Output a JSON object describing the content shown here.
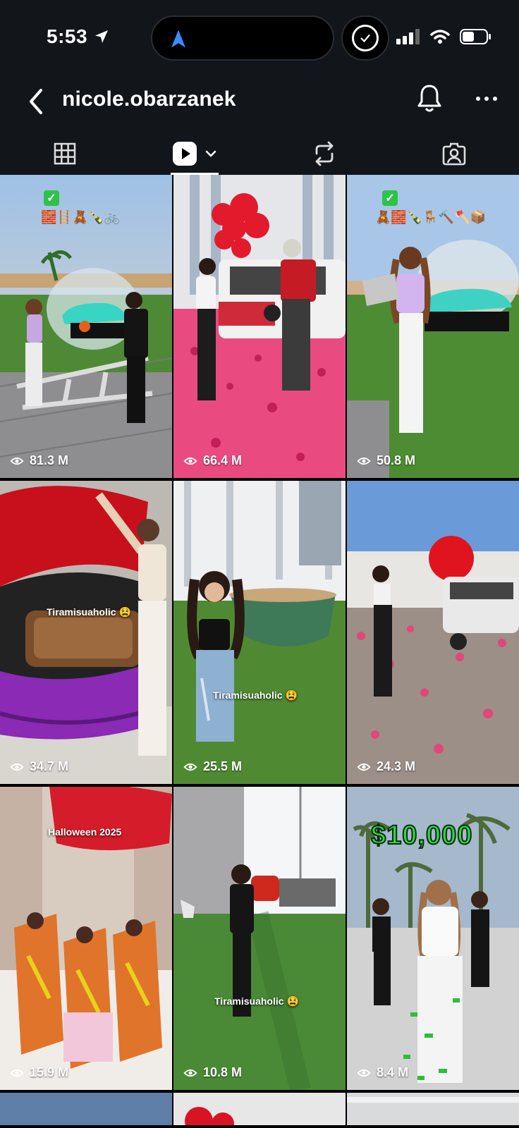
{
  "status_bar": {
    "time": "5:53"
  },
  "header": {
    "username": "nicole.obarzanek"
  },
  "tabs": [
    {
      "name": "grid",
      "active": false
    },
    {
      "name": "reels",
      "active": true
    },
    {
      "name": "reposts",
      "active": false
    },
    {
      "name": "tagged",
      "active": false
    }
  ],
  "tiles": [
    {
      "views": "81.3 M",
      "caption": "",
      "emojis": "🧱🪜🧸🍾🚲"
    },
    {
      "views": "66.4 M",
      "caption": ""
    },
    {
      "views": "50.8 M",
      "caption": "",
      "emojis": "🧸🧱🍾🪑🔨🪓📦"
    },
    {
      "views": "34.7 M",
      "caption": "Tiramisuaholic 😫"
    },
    {
      "views": "25.5 M",
      "caption": "Tiramisuaholic 😫"
    },
    {
      "views": "24.3 M",
      "caption": ""
    },
    {
      "views": "15.9 M",
      "caption": "Halloween 2025"
    },
    {
      "views": "10.8 M",
      "caption": "Tiramisuaholic 😫"
    },
    {
      "views": "8.4 M",
      "caption": "$10,000"
    }
  ],
  "colors": {
    "background": "#000000",
    "header": "#12151a",
    "check_green": "#2ec24b",
    "price_green": "#2bd84a"
  }
}
